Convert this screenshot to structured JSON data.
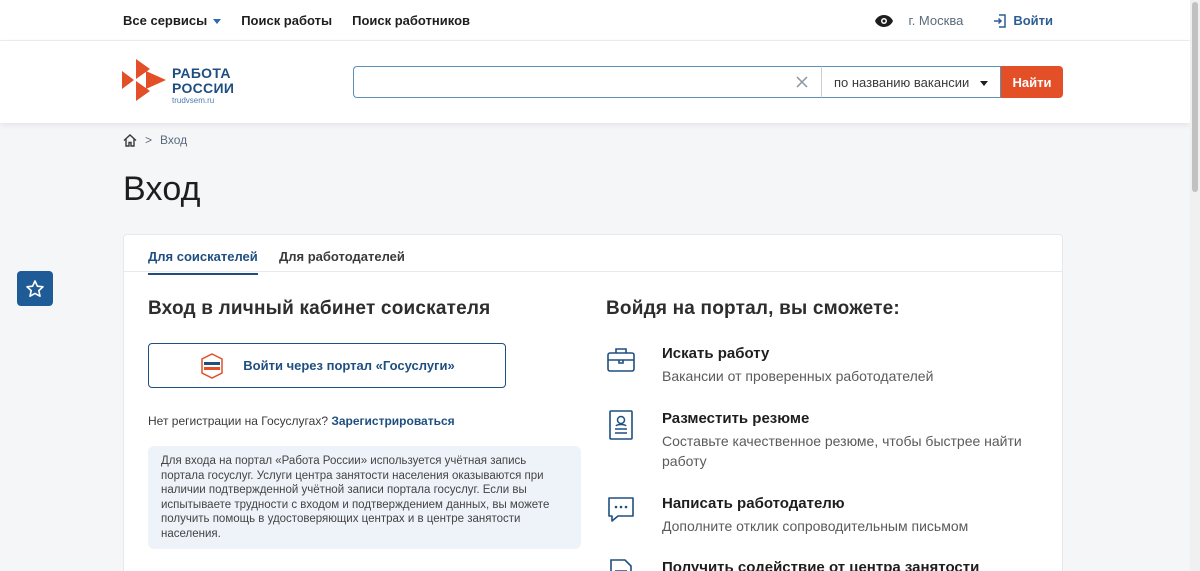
{
  "topnav": {
    "services": "Все сервисы",
    "job_search": "Поиск работы",
    "worker_search": "Поиск работников",
    "city": "г. Москва",
    "login": "Войти"
  },
  "logo": {
    "line1": "РАБОТА",
    "line2": "РОССИИ",
    "url": "trudvsem.ru"
  },
  "search": {
    "value": "",
    "mode": "по названию вакансии",
    "button": "Найти"
  },
  "breadcrumb": {
    "separator": ">",
    "current": "Вход"
  },
  "page": {
    "title": "Вход"
  },
  "tabs": [
    {
      "label": "Для соискателей",
      "active": true
    },
    {
      "label": "Для работодателей",
      "active": false
    }
  ],
  "left": {
    "heading": "Вход в личный кабинет соискателя",
    "gosuslugi_button": "Войти через портал «Госуслуги»",
    "no_reg_text": "Нет регистрации на Госуслугах?",
    "register_link": "Зарегистрироваться",
    "info": "Для входа на портал «Работа России» используется учётная запись портала госуслуг. Услуги центра занятости населения оказываются при наличии подтвержденной учётной записи портала госуслуг. Если вы испытываете трудности с входом и подтверждением данных, вы можете получить помощь в удостоверяющих центрах и в центре занятости населения."
  },
  "right": {
    "heading": "Войдя на портал, вы сможете:",
    "features": [
      {
        "icon": "briefcase-icon",
        "title": "Искать работу",
        "desc": "Вакансии от проверенных работодателей"
      },
      {
        "icon": "resume-icon",
        "title": "Разместить резюме",
        "desc": "Составьте качественное резюме, чтобы быстрее найти работу"
      },
      {
        "icon": "chat-icon",
        "title": "Написать работодателю",
        "desc": "Дополните отклик сопроводительным письмом"
      },
      {
        "icon": "document-icon",
        "title": "Получить содействие от центра занятости",
        "desc": ""
      }
    ]
  },
  "colors": {
    "brand_blue": "#1f4f80",
    "accent_orange": "#e35028",
    "fav_blue": "#1f5c97"
  }
}
